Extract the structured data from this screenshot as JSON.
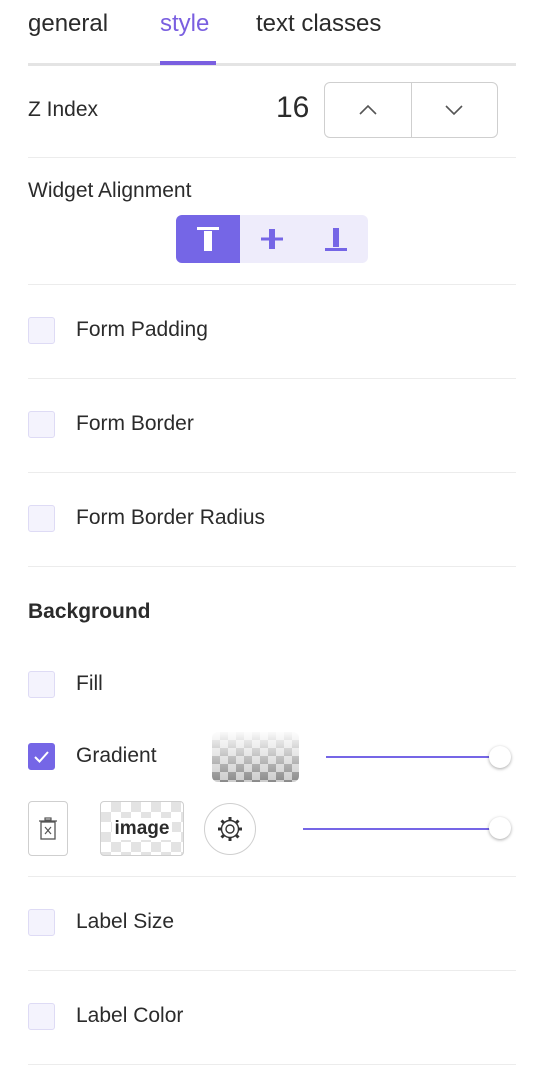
{
  "tabs": [
    {
      "label": "general",
      "active": false
    },
    {
      "label": "style",
      "active": true
    },
    {
      "label": "text classes",
      "active": false
    }
  ],
  "z_index": {
    "label": "Z Index",
    "value": "16",
    "up_icon": "chevron-up-icon",
    "down_icon": "chevron-down-icon"
  },
  "widget_alignment": {
    "label": "Widget Alignment",
    "options": [
      "align-top-icon",
      "align-center-icon",
      "align-bottom-icon"
    ],
    "selected": "align-top-icon"
  },
  "checkboxes": {
    "form_padding": {
      "label": "Form Padding",
      "checked": false
    },
    "form_border": {
      "label": "Form Border",
      "checked": false
    },
    "form_border_radius": {
      "label": "Form Border Radius",
      "checked": false
    }
  },
  "background": {
    "title": "Background",
    "fill": {
      "label": "Fill",
      "checked": false
    },
    "gradient": {
      "label": "Gradient",
      "checked": true,
      "opacity_level": 1.0
    },
    "image_button_label": "image",
    "image_opacity_level": 1.0
  },
  "label_size": {
    "label": "Label Size",
    "checked": false
  },
  "label_color": {
    "label": "Label Color",
    "checked": false
  },
  "colors": {
    "accent": "#7566e6",
    "tab_active": "#7a5fe0",
    "checkbox_bg": "#f4f3fd"
  }
}
